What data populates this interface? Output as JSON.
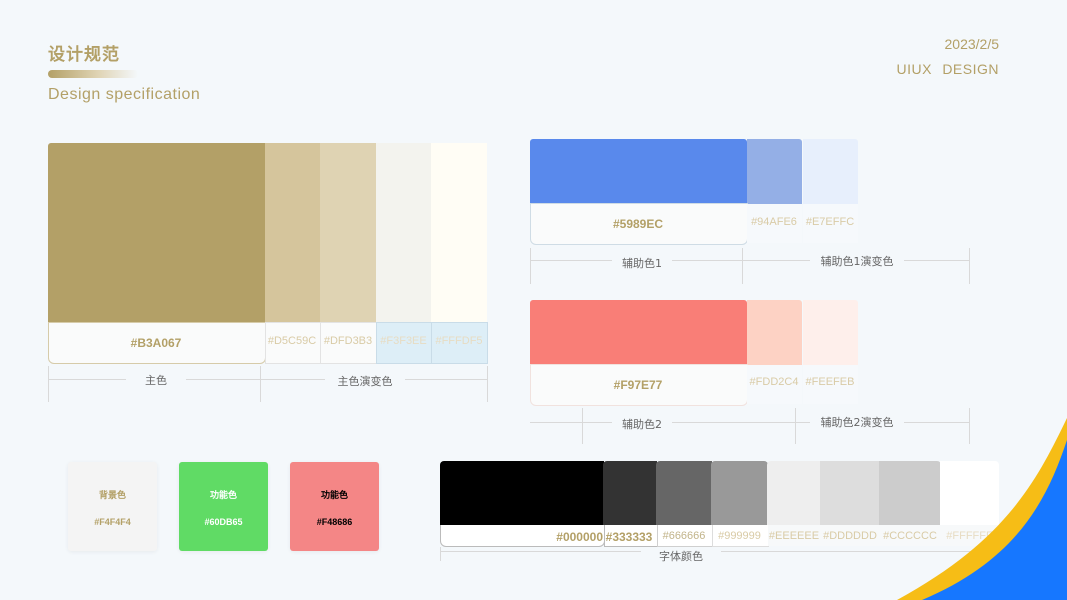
{
  "header": {
    "title_zh": "设计规范",
    "title_en": "Design specification",
    "date": "2023/2/5",
    "brand": "UIUX  DESIGN"
  },
  "primary": {
    "main": {
      "hex": "#B3A067",
      "color": "#B3A067"
    },
    "gradients": [
      {
        "hex": "#D5C59C",
        "color": "#D5C59C"
      },
      {
        "hex": "#DFD3B3",
        "color": "#DFD3B3"
      },
      {
        "hex": "#F3F3EE",
        "color": "#F3F3EE"
      },
      {
        "hex": "#FFFDF5",
        "color": "#FFFDF5"
      }
    ],
    "label_main": "主色",
    "label_gradient": "主色演变色"
  },
  "aux1": {
    "main": {
      "hex": "#5989EC",
      "color": "#5989EC"
    },
    "gradients": [
      {
        "hex": "#94AFE6",
        "color": "#94AFE6"
      },
      {
        "hex": "#E7EFFC",
        "color": "#E7EFFC"
      }
    ],
    "label_main": "辅助色1",
    "label_gradient": "辅助色1演变色"
  },
  "aux2": {
    "main": {
      "hex": "#F97E77",
      "color": "#F97E77"
    },
    "gradients": [
      {
        "hex": "#FDD2C4",
        "color": "#FDD2C4"
      },
      {
        "hex": "#FEEFEB",
        "color": "#FEEFEB"
      }
    ],
    "label_main": "辅助色2",
    "label_gradient": "辅助色2演变色"
  },
  "cards": [
    {
      "name": "背景色",
      "hex": "#F4F4F4",
      "color": "#F4F4F4",
      "text_color": "#B3A067"
    },
    {
      "name": "功能色",
      "hex": "#60DB65",
      "color": "#60DB65",
      "text_color": "#FFFFFF"
    },
    {
      "name": "功能色",
      "hex": "#F48686",
      "color": "#F48686",
      "text_color": "#000000"
    }
  ],
  "font_colors": {
    "label": "字体颜色",
    "items": [
      {
        "hex": "#000000",
        "color": "#000000"
      },
      {
        "hex": "#333333",
        "color": "#333333"
      },
      {
        "hex": "#666666",
        "color": "#666666"
      },
      {
        "hex": "#999999",
        "color": "#999999"
      },
      {
        "hex": "#EEEEEE",
        "color": "#EEEEEE"
      },
      {
        "hex": "#DDDDDD",
        "color": "#DDDDDD"
      },
      {
        "hex": "#CCCCCC",
        "color": "#CCCCCC"
      },
      {
        "hex": "#FFFFFF",
        "color": "#FFFFFF"
      }
    ]
  },
  "decor": {
    "yellow": "#F6BD16",
    "blue": "#1677FF"
  }
}
